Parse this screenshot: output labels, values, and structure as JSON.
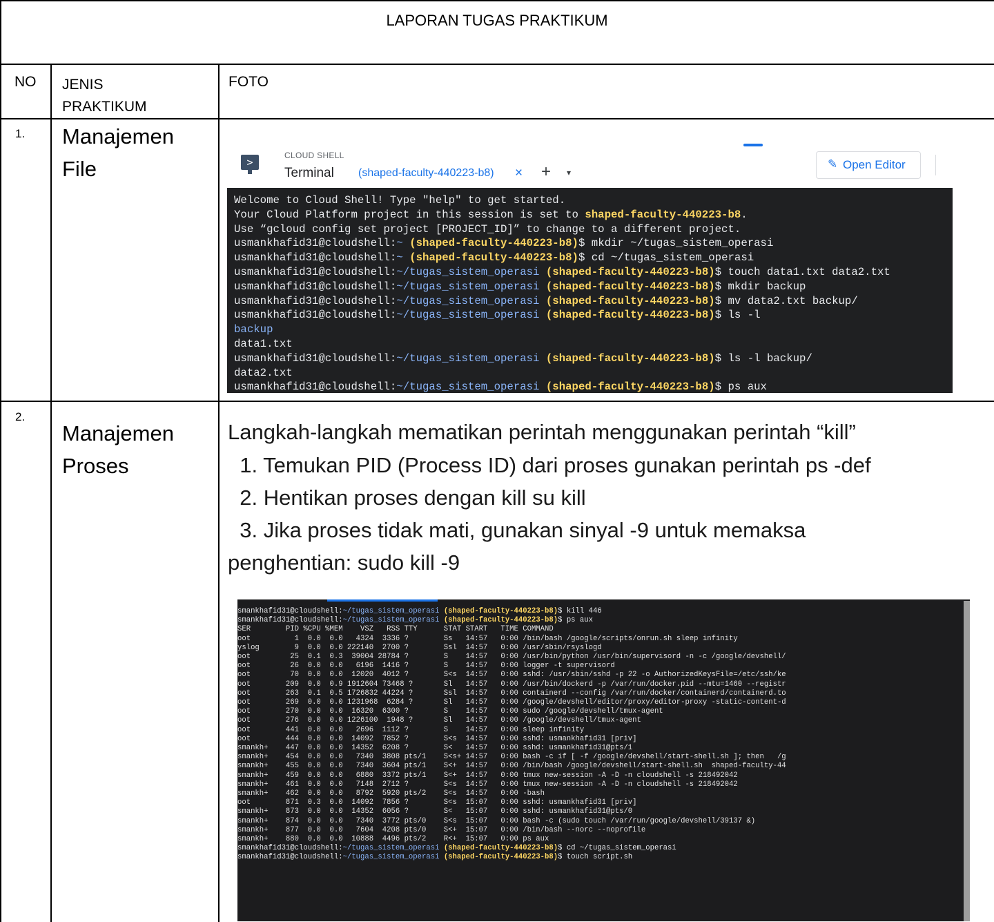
{
  "title": "LAPORAN TUGAS PRAKTIKUM",
  "header": {
    "no": "NO",
    "jenis_line1": "JENIS",
    "jenis_line2": "PRAKTIKUM",
    "foto": "FOTO"
  },
  "rows": [
    {
      "no": "1.",
      "jenis_line1": "Manajemen",
      "jenis_line2": "File"
    },
    {
      "no": "2.",
      "jenis_line1": "Manajemen",
      "jenis_line2": "Proses"
    }
  ],
  "cloud_shell": {
    "small_label": "CLOUD SHELL",
    "terminal_label": "Terminal",
    "tab_label": "(shaped-faculty-440223-b8)",
    "tab_close": "×",
    "add_tab": "+",
    "dropdown": "▾",
    "open_editor": "Open Editor",
    "prompt_icon": ">"
  },
  "terminal1": {
    "user": "usmankhafid31@cloudshell:",
    "project": "(shaped-faculty-440223-b8)",
    "lines": [
      {
        "type": "text",
        "text": "Welcome to Cloud Shell! Type \"help\" to get started."
      },
      {
        "type": "mixed",
        "pre": "Your Cloud Platform project in this session is set to ",
        "bold": "shaped-faculty-440223-b8",
        "post": "."
      },
      {
        "type": "text",
        "text": "Use “gcloud config set project [PROJECT_ID]” to change to a different project."
      },
      {
        "type": "prompt",
        "path": "~",
        "cmd": "$ mkdir ~/tugas_sistem_operasi"
      },
      {
        "type": "prompt",
        "path": "~",
        "cmd": "$ cd ~/tugas_sistem_operasi"
      },
      {
        "type": "prompt",
        "path": "~/tugas_sistem_operasi",
        "cmd": "$ touch data1.txt data2.txt"
      },
      {
        "type": "prompt",
        "path": "~/tugas_sistem_operasi",
        "cmd": "$ mkdir backup"
      },
      {
        "type": "prompt",
        "path": "~/tugas_sistem_operasi",
        "cmd": "$ mv data2.txt backup/"
      },
      {
        "type": "prompt",
        "path": "~/tugas_sistem_operasi",
        "cmd": "$ ls -l"
      },
      {
        "type": "dir",
        "text": "backup"
      },
      {
        "type": "text",
        "text": "data1.txt"
      },
      {
        "type": "prompt",
        "path": "~/tugas_sistem_operasi",
        "cmd": "$ ls -l backup/"
      },
      {
        "type": "text",
        "text": "data2.txt"
      },
      {
        "type": "prompt",
        "path": "~/tugas_sistem_operasi",
        "cmd": "$ ps aux"
      }
    ]
  },
  "steps": {
    "heading": "Langkah-langkah mematikan perintah menggunakan perintah “kill”",
    "step1": "  1. Temukan PID (Process ID) dari proses gunakan perintah ps -def",
    "step2": "  2. Hentikan proses dengan kill su kill",
    "step3": "  3. Jika proses tidak mati, gunakan sinyal -9 untuk memaksa",
    "step3_cont": "penghentian: sudo kill -9"
  },
  "terminal2": {
    "user": "smankhafid31@cloudshell:",
    "path": "~/tugas_sistem_operasi",
    "project": "(shaped-faculty-440223-b8)",
    "cmd1": "$ kill 446",
    "cmd2": "$ ps aux",
    "cmd3": "$ cd ~/tugas_sistem_operasi",
    "cmd4": "$ touch script.sh",
    "ps_lines": [
      "SER        PID %CPU %MEM    VSZ   RSS TTY      STAT START   TIME COMMAND",
      "oot          1  0.0  0.0   4324  3336 ?        Ss   14:57   0:00 /bin/bash /google/scripts/onrun.sh sleep infinity",
      "yslog        9  0.0  0.0 222140  2700 ?        Ssl  14:57   0:00 /usr/sbin/rsyslogd",
      "oot         25  0.1  0.3  39004 28784 ?        S    14:57   0:00 /usr/bin/python /usr/bin/supervisord -n -c /google/devshell/",
      "oot         26  0.0  0.0   6196  1416 ?        S    14:57   0:00 logger -t supervisord",
      "oot         70  0.0  0.0  12020  4012 ?        S<s  14:57   0:00 sshd: /usr/sbin/sshd -p 22 -o AuthorizedKeysFile=/etc/ssh/ke",
      "oot        209  0.0  0.9 1912604 73468 ?       Sl   14:57   0:00 /usr/bin/dockerd -p /var/run/docker.pid --mtu=1460 --registr",
      "oot        263  0.1  0.5 1726832 44224 ?       Ssl  14:57   0:00 containerd --config /var/run/docker/containerd/containerd.to",
      "oot        269  0.0  0.0 1231968  6284 ?       Sl   14:57   0:00 /google/devshell/editor/proxy/editor-proxy -static-content-d",
      "oot        270  0.0  0.0  16320  6300 ?        S    14:57   0:00 sudo /google/devshell/tmux-agent",
      "oot        276  0.0  0.0 1226100  1948 ?       Sl   14:57   0:00 /google/devshell/tmux-agent",
      "oot        441  0.0  0.0   2696  1112 ?        S    14:57   0:00 sleep infinity",
      "oot        444  0.0  0.0  14092  7852 ?        S<s  14:57   0:00 sshd: usmankhafid31 [priv]",
      "smankh+    447  0.0  0.0  14352  6208 ?        S<   14:57   0:00 sshd: usmankhafid31@pts/1",
      "smankh+    454  0.0  0.0   7340  3808 pts/1    S<s+ 14:57   0:00 bash -c if [ -f /google/devshell/start-shell.sh ]; then   /g",
      "smankh+    455  0.0  0.0   7340  3604 pts/1    S<+  14:57   0:00 /bin/bash /google/devshell/start-shell.sh  shaped-faculty-44",
      "smankh+    459  0.0  0.0   6880  3372 pts/1    S<+  14:57   0:00 tmux new-session -A -D -n cloudshell -s 218492042",
      "smankh+    461  0.0  0.0   7148  2712 ?        S<s  14:57   0:00 tmux new-session -A -D -n cloudshell -s 218492042",
      "smankh+    462  0.0  0.0   8792  5920 pts/2    S<s  14:57   0:00 -bash",
      "oot        871  0.3  0.0  14092  7856 ?        S<s  15:07   0:00 sshd: usmankhafid31 [priv]",
      "smankh+    873  0.0  0.0  14352  6056 ?        S<   15:07   0:00 sshd: usmankhafid31@pts/0",
      "smankh+    874  0.0  0.0   7340  3772 pts/0    S<s  15:07   0:00 bash -c (sudo touch /var/run/google/devshell/39137 &)",
      "smankh+    877  0.0  0.0   7604  4208 pts/0    S<+  15:07   0:00 /bin/bash --norc --noprofile",
      "smankh+    880  0.0  0.0  10888  4496 pts/2    R<+  15:07   0:00 ps aux"
    ]
  }
}
